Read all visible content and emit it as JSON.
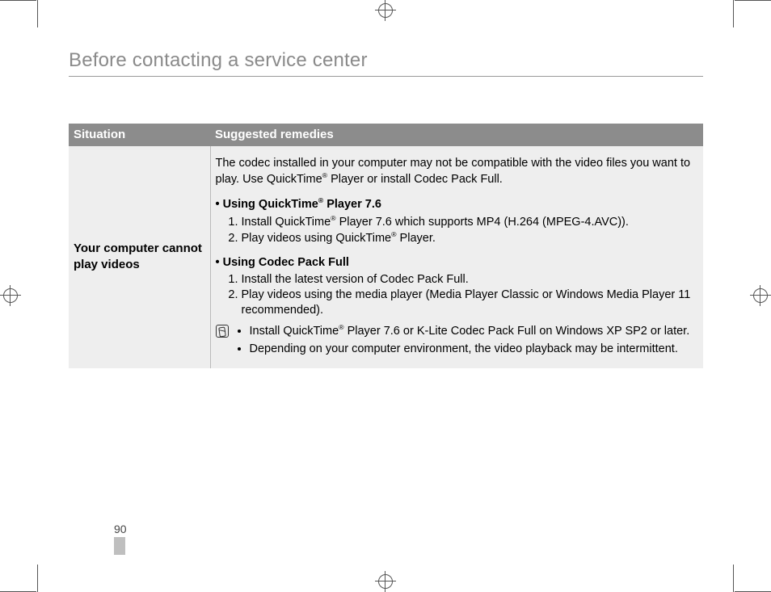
{
  "title": "Before contacting a service center",
  "table": {
    "header_situation": "Situation",
    "header_remedies": "Suggested remedies",
    "row": {
      "situation": "Your computer cannot play videos",
      "intro_a": "The codec installed in your computer may not be compatible with the video files you want to play. Use QuickTime",
      "intro_b": " Player or install Codec Pack Full.",
      "qt_head_a": "• Using QuickTime",
      "qt_head_b": " Player 7.6",
      "qt_step1_a": "Install QuickTime",
      "qt_step1_b": " Player 7.6 which supports MP4 (H.264 (MPEG-4.AVC)).",
      "qt_step2_a": "Play videos using QuickTime",
      "qt_step2_b": " Player.",
      "cp_head": "• Using Codec Pack Full",
      "cp_step1": "Install the latest version of Codec Pack Full.",
      "cp_step2": "Play videos using the media player (Media Player Classic or Windows Media Player 11 recommended).",
      "note1_a": "Install QuickTime",
      "note1_b": " Player 7.6 or K-Lite Codec Pack Full on Windows XP SP2 or later.",
      "note2": "Depending on your computer environment, the video playback may be intermittent."
    }
  },
  "reg": "®",
  "page_number": "90"
}
